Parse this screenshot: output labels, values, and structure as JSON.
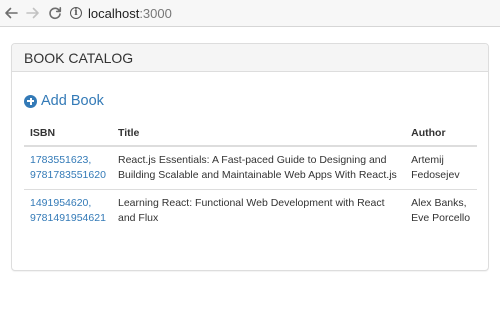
{
  "browser": {
    "url_host": "localhost",
    "url_port": ":3000",
    "back_icon": "arrow-left-icon",
    "forward_icon": "arrow-right-icon",
    "reload_icon": "reload-icon",
    "info_icon": "info-icon"
  },
  "panel": {
    "heading": "BOOK CATALOG",
    "add_button_label": "Add Book",
    "add_button_icon": "plus-circle-icon",
    "accent_color": "#337ab7"
  },
  "table": {
    "headers": [
      "ISBN",
      "Title",
      "Author"
    ],
    "rows": [
      {
        "isbn_line1": "1783551623,",
        "isbn_line2": "9781783551620",
        "title": "React.js Essentials: A Fast-paced Guide to Designing and Building Scalable and Maintainable Web Apps With React.js",
        "author": "Artemij Fedosejev"
      },
      {
        "isbn_line1": "1491954620,",
        "isbn_line2": "9781491954621",
        "title": "Learning React: Functional Web Development with React and Flux",
        "author": "Alex Banks, Eve Porcello"
      }
    ]
  }
}
